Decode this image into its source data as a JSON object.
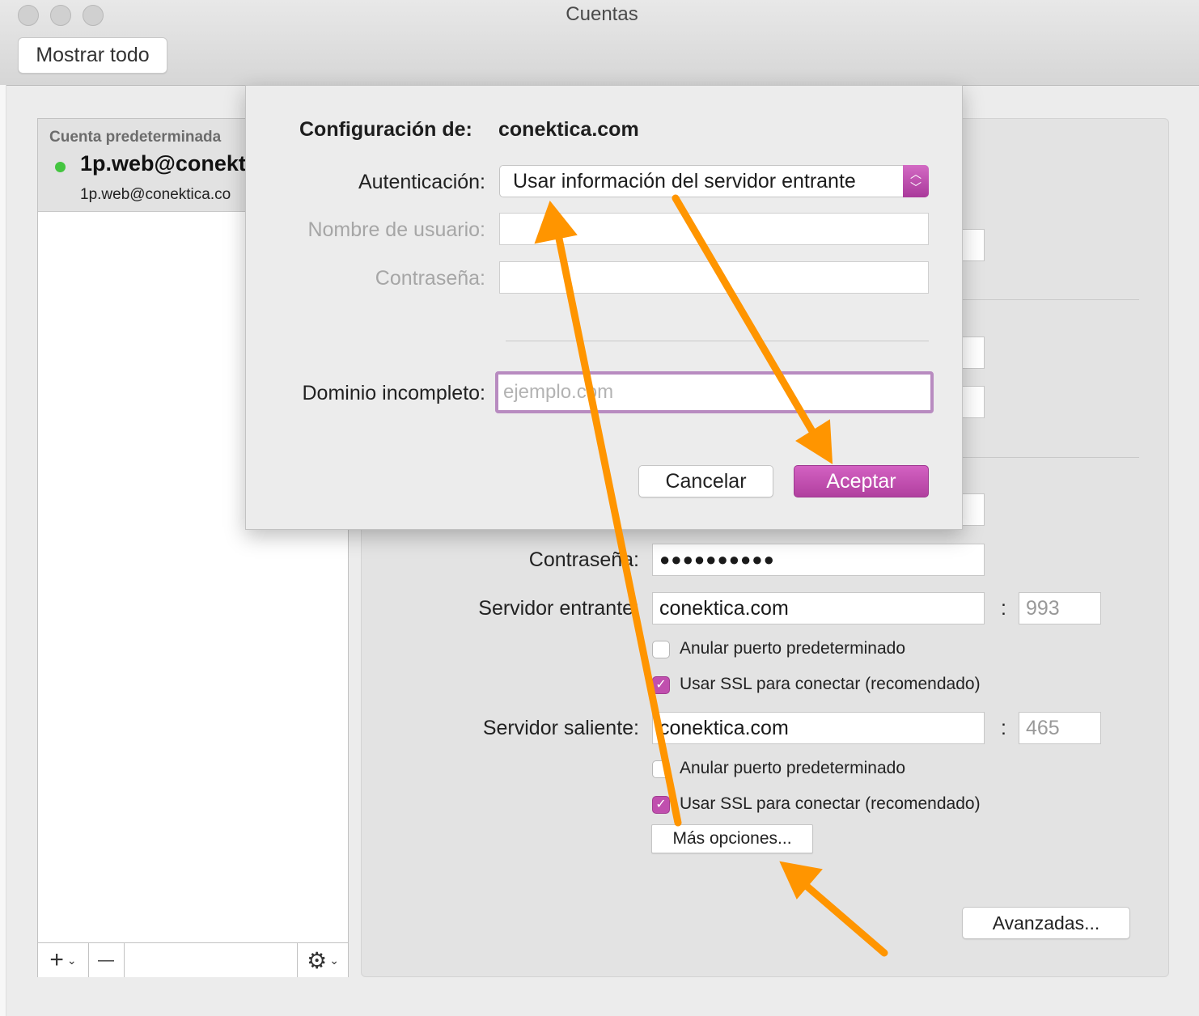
{
  "window": {
    "title": "Cuentas",
    "show_all": "Mostrar todo"
  },
  "account_list": {
    "section_label": "Cuenta predeterminada",
    "account_name": "1p.web@conekt",
    "account_email": "1p.web@conektica.co",
    "add_label": "+",
    "remove_label": "—"
  },
  "settings": {
    "password_label": "Contraseña:",
    "password_value": "●●●●●●●●●●",
    "incoming_label": "Servidor entrante:",
    "incoming_value": "conektica.com",
    "incoming_port": "993",
    "outgoing_label": "Servidor saliente:",
    "outgoing_value": "conektica.com",
    "outgoing_port": "465",
    "port_separator": ":",
    "override_port_label": "Anular puerto predeterminado",
    "use_ssl_label": "Usar SSL para conectar (recomendado)",
    "incoming_override_checked": false,
    "incoming_ssl_checked": true,
    "outgoing_override_checked": false,
    "outgoing_ssl_checked": true,
    "more_options_button": "Más opciones...",
    "advanced_button": "Avanzadas..."
  },
  "sheet": {
    "config_label": "Configuración de:",
    "config_value": "conektica.com",
    "auth_label": "Autenticación:",
    "auth_value": "Usar información del servidor entrante",
    "username_label": "Nombre de usuario:",
    "password_label": "Contraseña:",
    "domain_label": "Dominio incompleto:",
    "domain_placeholder": "ejemplo.com",
    "cancel_button": "Cancelar",
    "accept_button": "Aceptar"
  },
  "colors": {
    "accent": "#b1409f",
    "annotation_arrow": "#ff9500",
    "status_online": "#44c540"
  }
}
